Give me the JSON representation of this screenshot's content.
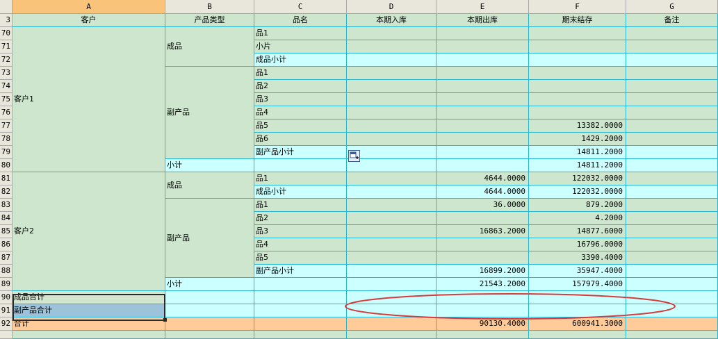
{
  "columns": [
    "A",
    "B",
    "C",
    "D",
    "E",
    "F",
    "G"
  ],
  "row_numbers": [
    "3",
    "70",
    "71",
    "72",
    "73",
    "74",
    "75",
    "76",
    "77",
    "78",
    "79",
    "80",
    "81",
    "82",
    "83",
    "84",
    "85",
    "86",
    "87",
    "88",
    "89",
    "90",
    "91",
    "92"
  ],
  "headers": [
    "客户",
    "产品类型",
    "品名",
    "本期入库",
    "本期出库",
    "期末结存",
    "备注"
  ],
  "customers": [
    "客户1",
    "客户2"
  ],
  "product_types": {
    "c1_finished": "成品",
    "c1_byproduct": "副产品",
    "c1_subtotal": "小计",
    "c2_finished": "成品",
    "c2_byproduct": "副产品",
    "c2_subtotal": "小计"
  },
  "rows": [
    {
      "name": "品1",
      "in": "",
      "out": "",
      "bal": ""
    },
    {
      "name": "小片",
      "in": "",
      "out": "",
      "bal": ""
    },
    {
      "name": "成品小计",
      "in": "",
      "out": "",
      "bal": ""
    },
    {
      "name": "品1",
      "in": "",
      "out": "",
      "bal": ""
    },
    {
      "name": "品2",
      "in": "",
      "out": "",
      "bal": ""
    },
    {
      "name": "品3",
      "in": "",
      "out": "",
      "bal": ""
    },
    {
      "name": "品4",
      "in": "",
      "out": "",
      "bal": ""
    },
    {
      "name": "品5",
      "in": "",
      "out": "",
      "bal": "13382.0000"
    },
    {
      "name": "品6",
      "in": "",
      "out": "",
      "bal": "1429.2000"
    },
    {
      "name": "副产品小计",
      "in": "",
      "out": "",
      "bal": "14811.2000"
    },
    {
      "name": "",
      "in": "",
      "out": "",
      "bal": "14811.2000"
    },
    {
      "name": "品1",
      "in": "",
      "out": "4644.0000",
      "bal": "122032.0000"
    },
    {
      "name": "成品小计",
      "in": "",
      "out": "4644.0000",
      "bal": "122032.0000"
    },
    {
      "name": "品1",
      "in": "",
      "out": "36.0000",
      "bal": "879.2000"
    },
    {
      "name": "品2",
      "in": "",
      "out": "",
      "bal": "4.2000"
    },
    {
      "name": "品3",
      "in": "",
      "out": "16863.2000",
      "bal": "14877.6000"
    },
    {
      "name": "品4",
      "in": "",
      "out": "",
      "bal": "16796.0000"
    },
    {
      "name": "品5",
      "in": "",
      "out": "",
      "bal": "3390.4000"
    },
    {
      "name": "副产品小计",
      "in": "",
      "out": "16899.2000",
      "bal": "35947.4000"
    },
    {
      "name": "",
      "in": "",
      "out": "21543.2000",
      "bal": "157979.4000"
    },
    {
      "name": "",
      "in": "",
      "out": "",
      "bal": ""
    },
    {
      "name": "",
      "in": "",
      "out": "",
      "bal": ""
    },
    {
      "name": "",
      "in": "",
      "out": "90130.4000",
      "bal": "600941.3000"
    }
  ],
  "totals": {
    "finished_total": "成品合计",
    "byproduct_total": "副产品合计",
    "grand_total": "合计"
  },
  "colors": {
    "green": "#cde6cd",
    "cyan": "#ccffff",
    "orange": "#ffcc99",
    "grid": "#27b6d3",
    "annotation_ellipse": "#d63c3c"
  },
  "active_column": "A",
  "selected_range": "A90:A91"
}
